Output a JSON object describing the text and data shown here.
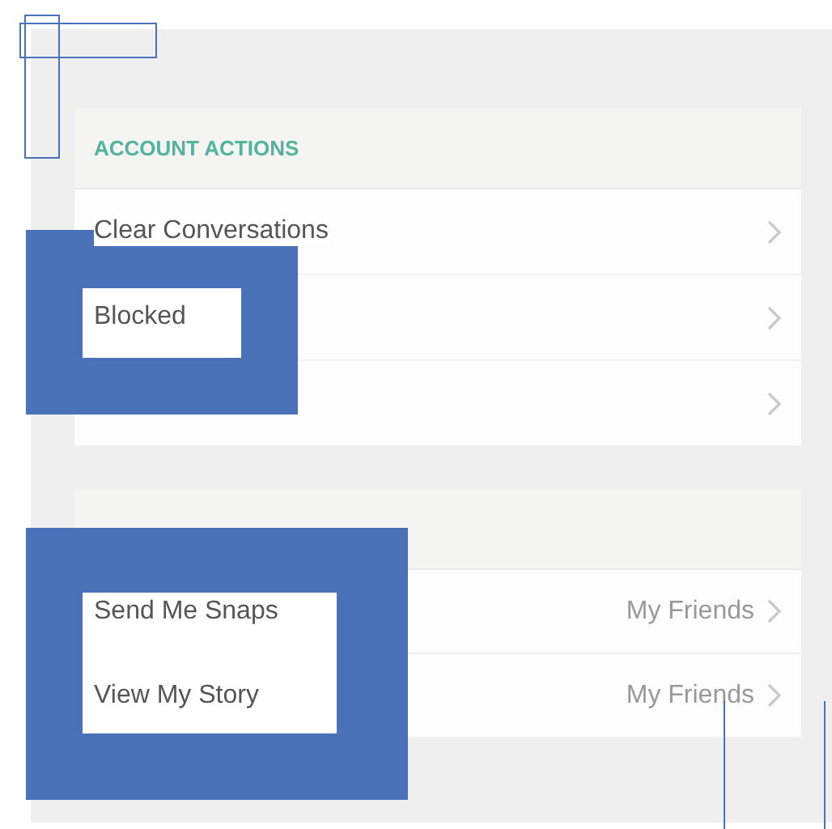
{
  "sections": [
    {
      "header": "ACCOUNT ACTIONS",
      "rows": [
        {
          "label": "Clear Conversations"
        },
        {
          "label": "Blocked"
        },
        {}
      ]
    },
    {
      "rows": [
        {
          "label": "Send Me Snaps",
          "value": "My Friends"
        },
        {
          "label": "View My Story",
          "value": "My Friends"
        }
      ]
    }
  ]
}
